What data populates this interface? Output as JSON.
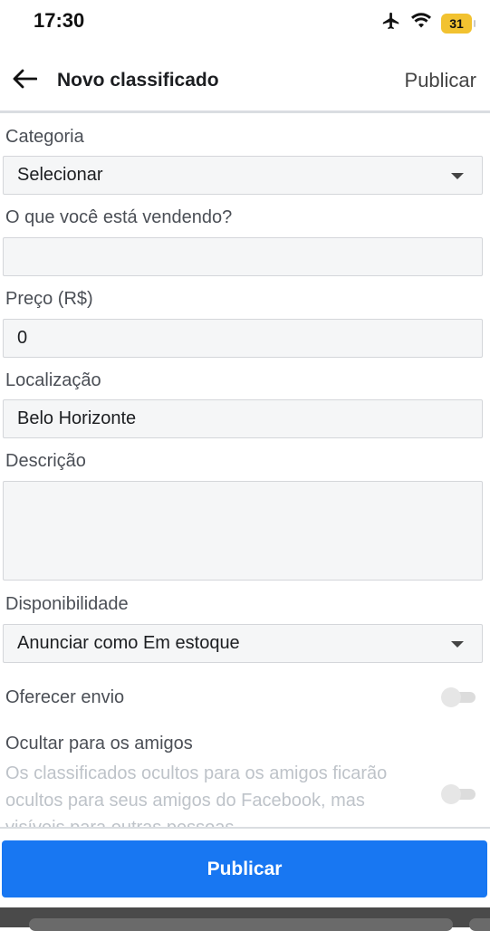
{
  "status_bar": {
    "time": "17:30",
    "battery": "31"
  },
  "header": {
    "title": "Novo classificado",
    "publish_link": "Publicar"
  },
  "form": {
    "category": {
      "label": "Categoria",
      "value": "Selecionar"
    },
    "item": {
      "label": "O que você está vendendo?",
      "value": ""
    },
    "price": {
      "label": "Preço (R$)",
      "value": "0"
    },
    "location": {
      "label": "Localização",
      "value": "Belo Horizonte"
    },
    "description": {
      "label": "Descrição",
      "value": ""
    },
    "availability": {
      "label": "Disponibilidade",
      "value": "Anunciar como Em estoque"
    },
    "shipping": {
      "label": "Oferecer envio",
      "enabled": false
    },
    "hide_friends": {
      "label": "Ocultar para os amigos",
      "hint": "Os classificados ocultos para os amigos ficarão ocultos para seus amigos do Facebook, mas visíveis para outras pessoas",
      "enabled": false
    }
  },
  "footer": {
    "publish_button": "Publicar"
  },
  "colors": {
    "accent": "#1877f2",
    "battery": "#f2c230",
    "field_bg": "#f5f6f7"
  }
}
